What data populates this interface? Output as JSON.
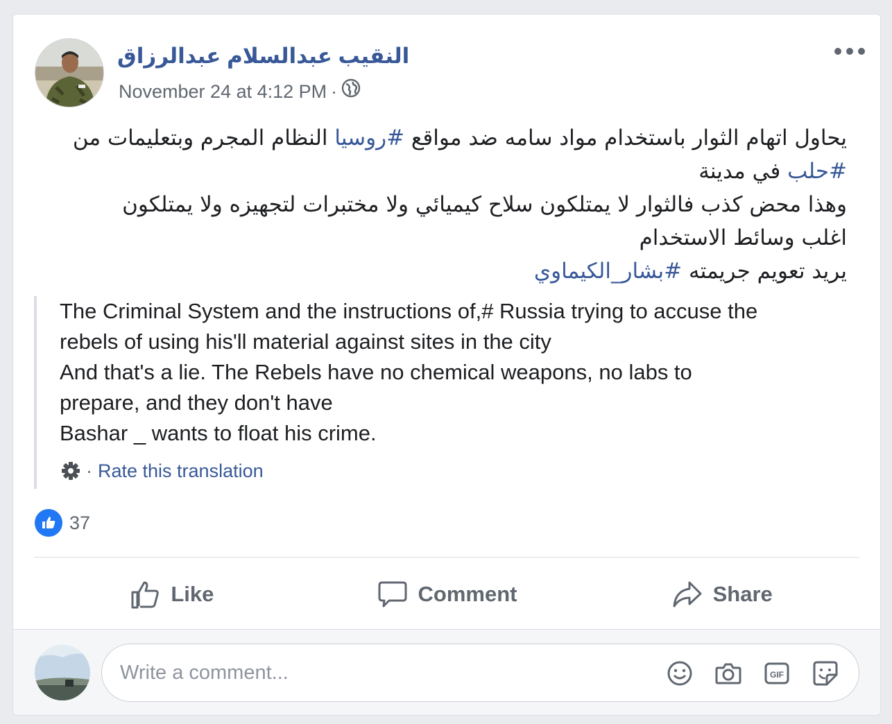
{
  "post": {
    "author": "النقيب عبدالسلام عبدالرزاق",
    "timestamp": "November 24 at 4:12 PM",
    "meta_separator": "·",
    "privacy_icon": "globe-icon",
    "more_icon": "more-options-icon",
    "arabic_text": {
      "line1_part1": "يحاول اتهام الثوار باستخدام مواد سامه ضد مواقع ",
      "line1_hashtag": "#روسيا",
      "line1_part2": " النظام المجرم وبتعليمات من",
      "line2_hashtag": "#حلب",
      "line2_part": " في مدينة",
      "line3": "وهذا محض كذب فالثوار لا يمتلكون سلاح كيميائي ولا مختبرات لتجهيزه ولا يمتلكون",
      "line4": "اغلب وسائط الاستخدام",
      "line5_part": "يريد تعويم جريمته ",
      "line5_hashtag": "#بشار_الكيماوي"
    },
    "translation": {
      "lines": [
        "The Criminal System and the instructions of,# Russia trying to accuse the",
        "rebels of using his'll material against sites in the city",
        "And that's a lie. The Rebels have no chemical weapons, no labs to",
        "prepare, and they don't have",
        "Bashar _ wants to float his crime."
      ],
      "rate_separator": "·",
      "rate_label": "Rate this translation"
    },
    "reactions": {
      "like_count": "37"
    },
    "actions": {
      "like": "Like",
      "comment": "Comment",
      "share": "Share"
    },
    "comment_box": {
      "placeholder": "Write a comment..."
    }
  },
  "colors": {
    "link": "#385898",
    "like_blue": "#2078f4",
    "secondary_text": "#606770"
  }
}
